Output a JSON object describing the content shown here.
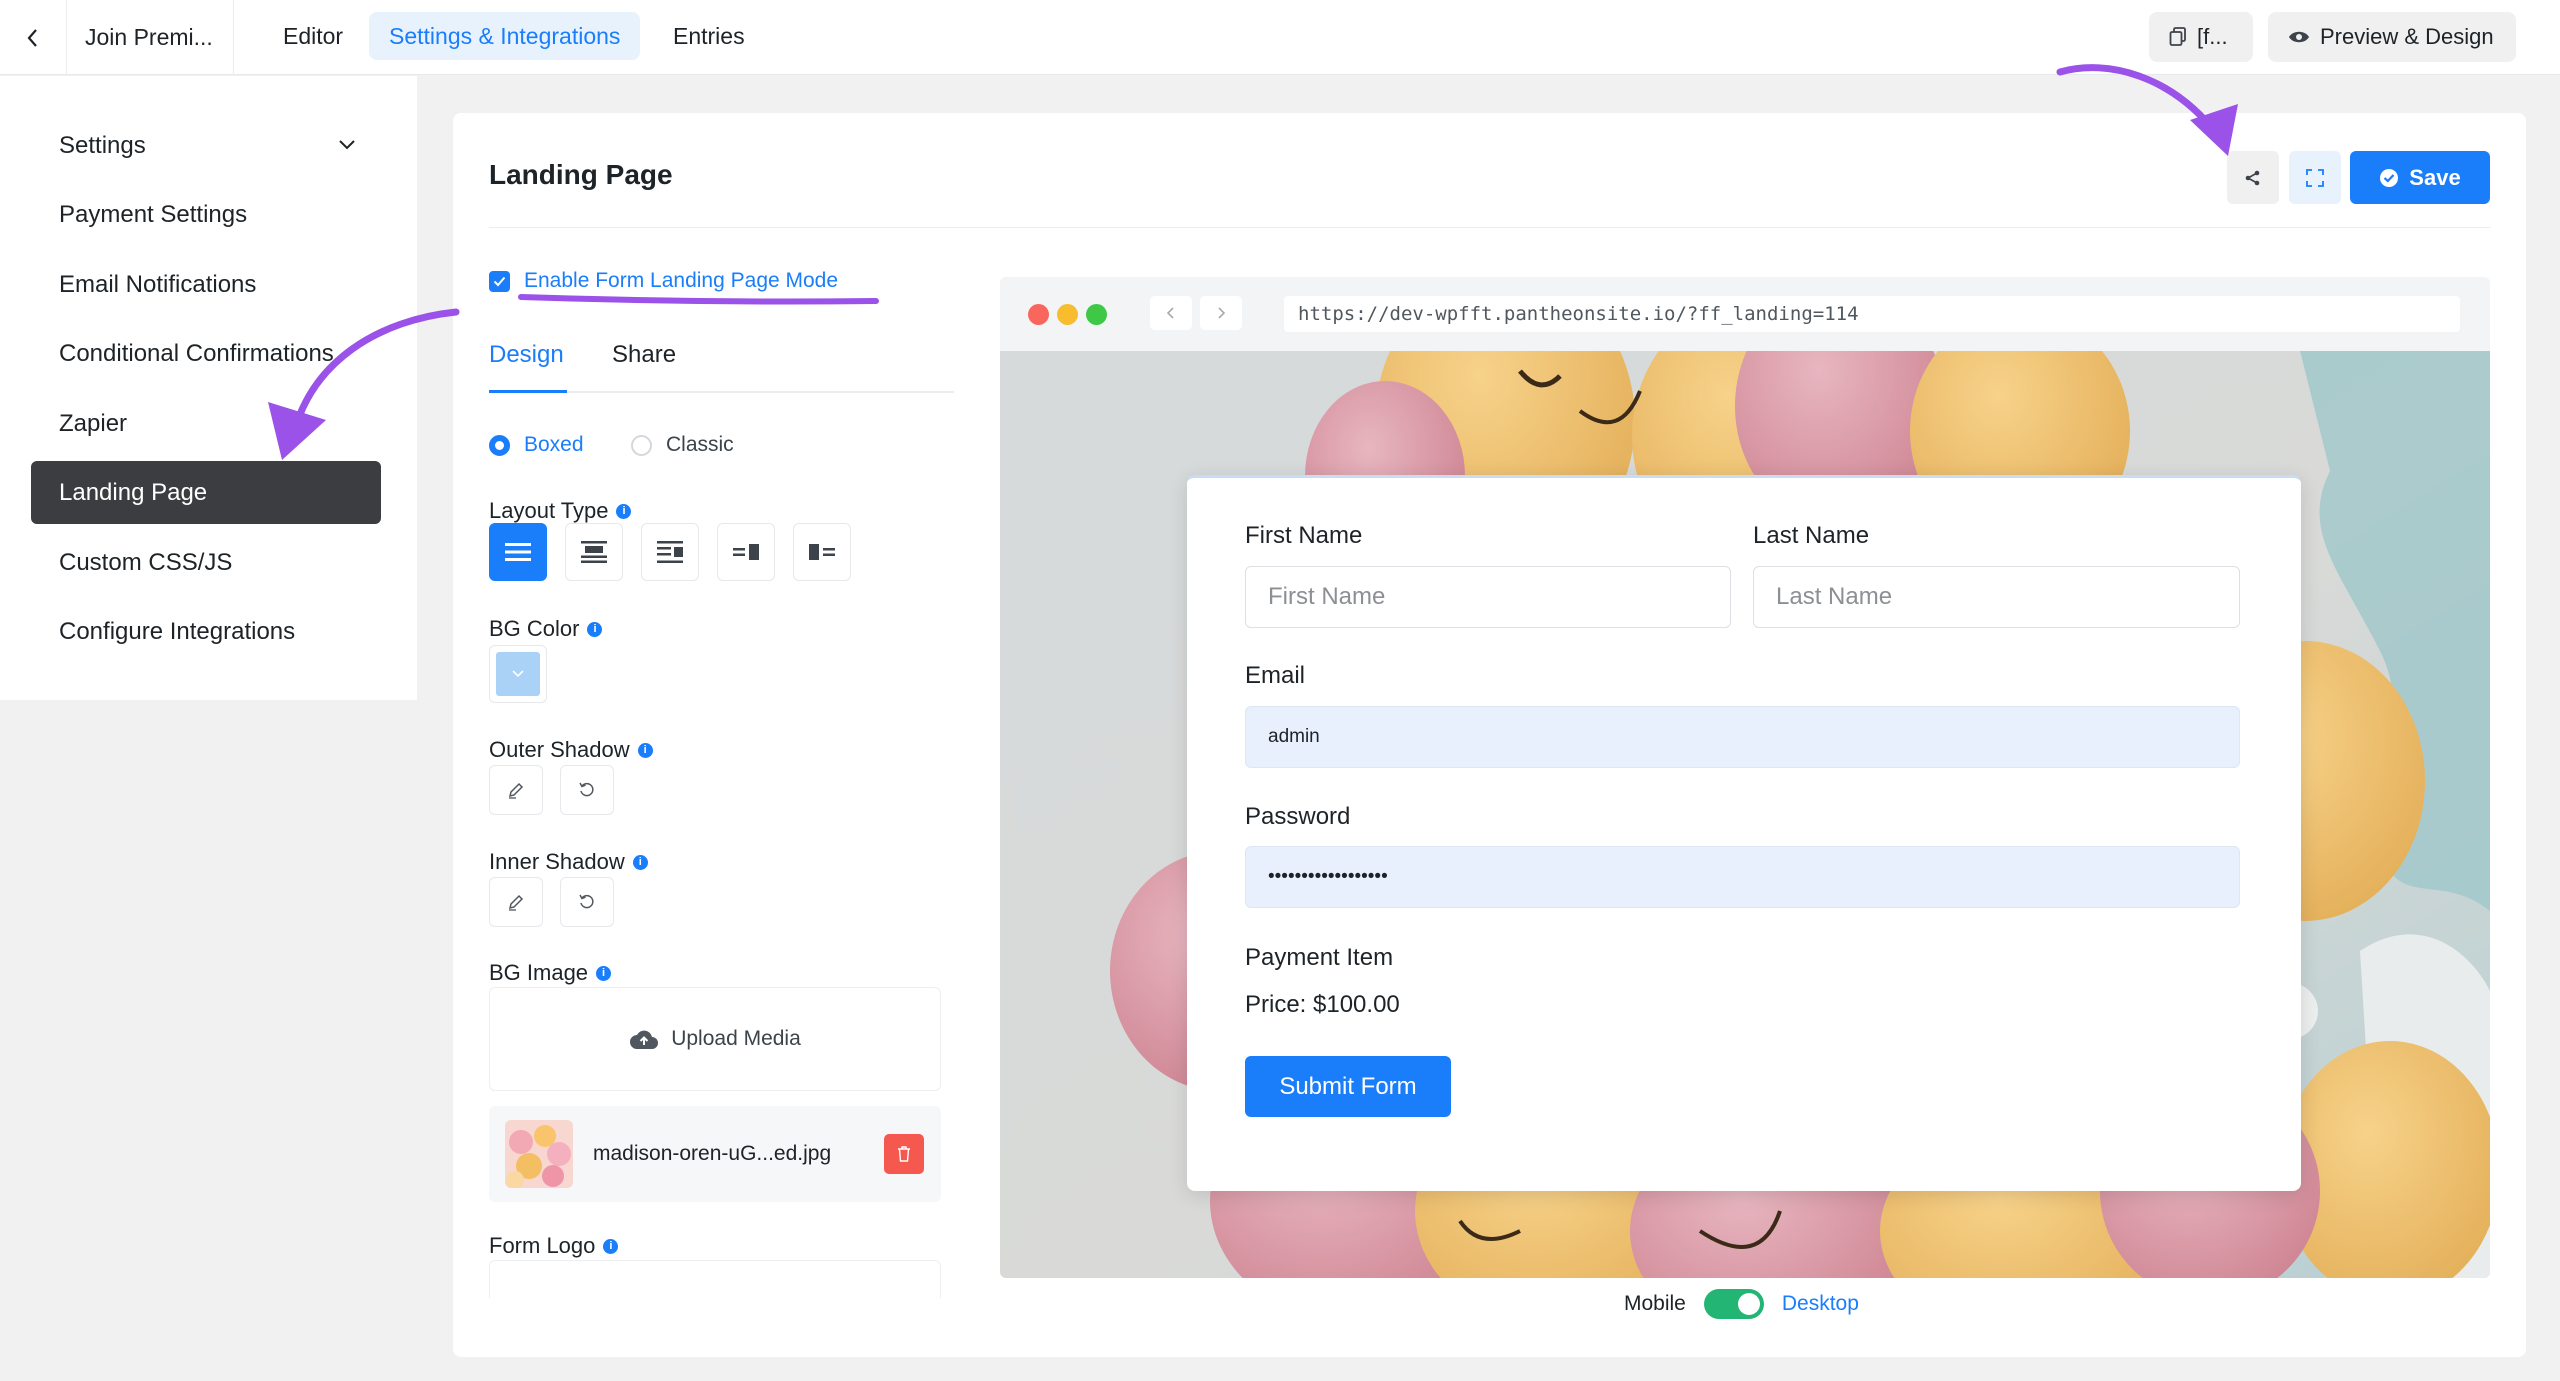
{
  "topbar": {
    "form_title": "Join Premi...",
    "tabs": [
      "Editor",
      "Settings & Integrations",
      "Entries"
    ],
    "shortcode_label": "[f...",
    "preview_label": "Preview & Design"
  },
  "sidebar": {
    "items": [
      {
        "label": "Settings"
      },
      {
        "label": "Payment Settings"
      },
      {
        "label": "Email Notifications"
      },
      {
        "label": "Conditional Confirmations"
      },
      {
        "label": "Zapier"
      },
      {
        "label": "Landing Page"
      },
      {
        "label": "Custom CSS/JS"
      },
      {
        "label": "Configure Integrations"
      }
    ]
  },
  "panel": {
    "title": "Landing Page",
    "save_label": "Save",
    "enable_label": "Enable Form Landing Page Mode",
    "tabs": [
      "Design",
      "Share"
    ],
    "style_options": [
      "Boxed",
      "Classic"
    ],
    "layout_type_label": "Layout Type",
    "bg_color_label": "BG Color",
    "bg_color_value": "#a9d2f6",
    "outer_shadow_label": "Outer Shadow",
    "inner_shadow_label": "Inner Shadow",
    "bg_image_label": "BG Image",
    "upload_label": "Upload Media",
    "file_name": "madison-oren-uG...ed.jpg",
    "form_logo_label": "Form Logo"
  },
  "preview": {
    "url": "https://dev-wpfft.pantheonsite.io/?ff_landing=114",
    "form": {
      "first_name_label": "First Name",
      "first_name_placeholder": "First Name",
      "last_name_label": "Last Name",
      "last_name_placeholder": "Last Name",
      "email_label": "Email",
      "email_value": "admin",
      "password_label": "Password",
      "password_value": "••••••••••••••••••",
      "payment_item_label": "Payment Item",
      "price_text": "Price: $100.00",
      "submit_label": "Submit Form"
    },
    "mobile_label": "Mobile",
    "desktop_label": "Desktop"
  },
  "colors": {
    "accent": "#1a7efb",
    "annotation": "#9a52e8",
    "toggle_on": "#22b573",
    "delete": "#f5584e"
  }
}
